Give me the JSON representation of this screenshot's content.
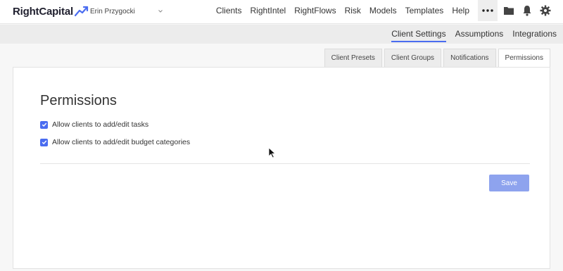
{
  "app": {
    "logo_text": "RightCapital"
  },
  "client_select": {
    "value": "Erin Przygocki"
  },
  "nav": {
    "items": [
      "Clients",
      "RightIntel",
      "RightFlows",
      "Risk",
      "Models",
      "Templates",
      "Help"
    ],
    "more_icon": "ellipsis-icon",
    "icons": [
      "folder-icon",
      "bell-icon",
      "gear-icon"
    ]
  },
  "subnav": {
    "items": [
      "Client Settings",
      "Assumptions",
      "Integrations"
    ],
    "active": "Client Settings"
  },
  "tabs": {
    "items": [
      "Client Presets",
      "Client Groups",
      "Notifications",
      "Permissions"
    ],
    "active": "Permissions"
  },
  "permissions": {
    "title": "Permissions",
    "options": [
      {
        "label": "Allow clients to add/edit tasks",
        "checked": true
      },
      {
        "label": "Allow clients to add/edit budget categories",
        "checked": true
      }
    ],
    "save_label": "Save"
  },
  "colors": {
    "accent": "#4a6cf0",
    "save_button": "#8ea3ee"
  }
}
